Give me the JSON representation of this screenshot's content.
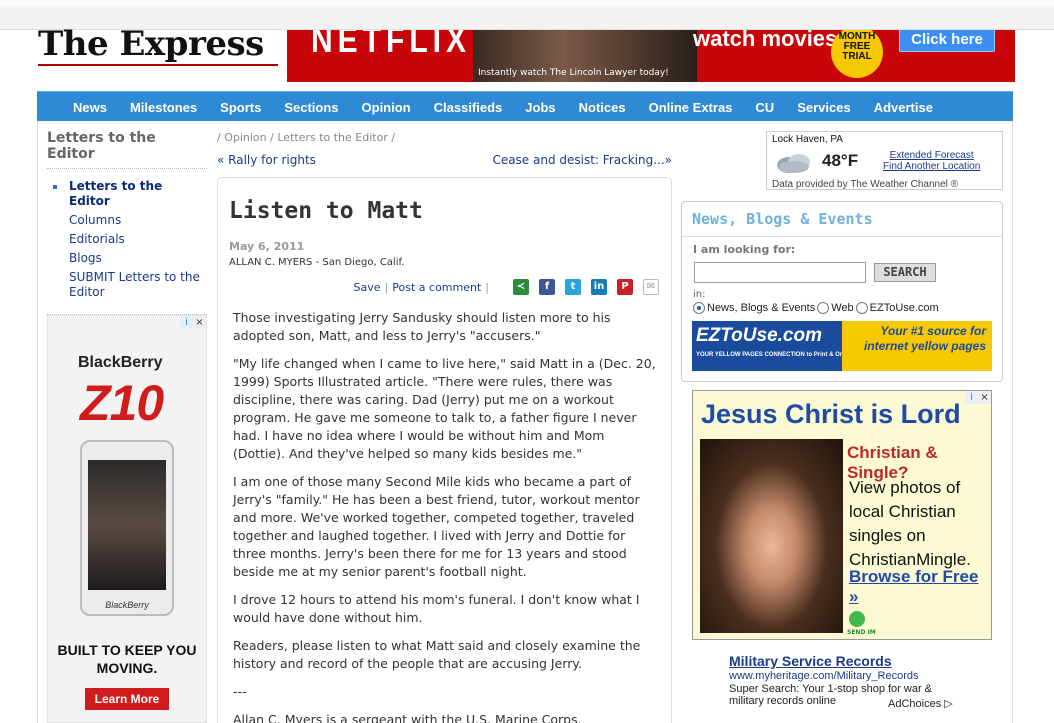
{
  "logo": {
    "title": "The Express"
  },
  "top_ad": {
    "brand": "NETFLIX",
    "caption": "Instantly watch The Lincoln Lawyer today!",
    "headline": "watch movies",
    "badge": "MONTH FREE TRIAL",
    "cta": "Click here"
  },
  "nav": {
    "items": [
      "News",
      "Milestones",
      "Sports",
      "Sections",
      "Opinion",
      "Classifieds",
      "Jobs",
      "Notices",
      "Online Extras",
      "CU",
      "Services",
      "Advertise"
    ]
  },
  "sidebar": {
    "title": "Letters to the Editor",
    "items": [
      {
        "label": "Letters to the Editor",
        "active": true
      },
      {
        "label": "Columns"
      },
      {
        "label": "Editorials"
      },
      {
        "label": "Blogs"
      },
      {
        "label": "SUBMIT Letters to the Editor"
      }
    ]
  },
  "left_ad": {
    "brand": "BlackBerry",
    "model": "Z10",
    "phone_label": "BlackBerry",
    "tagline": "BUILT TO KEEP YOU MOVING.",
    "cta": "Learn More"
  },
  "breadcrumb": "/ Opinion / Letters to the Editor /",
  "prev_link": "« Rally for rights",
  "next_link": "Cease and desist: Fracking...»",
  "article": {
    "title": "Listen to Matt",
    "date": "May 6, 2011",
    "byline": "ALLAN C. MYERS - San Diego, Calif.",
    "save": "Save",
    "separator": "|",
    "post_comment": "Post a comment",
    "share_separator": "|",
    "paragraphs": [
      "Those investigating Jerry Sandusky should listen more to his adopted son, Matt, and less to Jerry's \"accusers.\"",
      "\"My life changed when I came to live here,\" said Matt in a (Dec. 20, 1999) Sports Illustrated article. \"There were rules, there was discipline, there was caring. Dad (Jerry) put me on a workout program. He gave me someone to talk to, a father figure I never had. I have no idea where I would be without him and Mom (Dottie). And they've helped so many kids besides me.\"",
      "I am one of those many Second Mile kids who became a part of Jerry's \"family.\" He has been a best friend, tutor, workout mentor and more. We've worked together, competed together, traveled together and laughed together. I lived with Jerry and Dottie for three months. Jerry's been there for me for 13 years and stood beside me at my senior parent's football night.",
      "I drove 12 hours to attend his mom's funeral. I don't know what I would have done without him.",
      "Readers, please listen to what Matt said and closely examine the history and record of the people that are accusing Jerry.",
      "---",
      "Allan C. Myers is a sergeant with the U.S. Marine Corps."
    ]
  },
  "weather": {
    "location": "Lock Haven, PA",
    "temp": "48°F",
    "extended": "Extended Forecast",
    "another": "Find Another Location",
    "provider": "Data provided by The Weather Channel ®"
  },
  "search_box": {
    "title": "News, Blogs & Events",
    "label": "I am looking for:",
    "button": "SEARCH",
    "in_label": "in:",
    "options": [
      "News, Blogs & Events",
      "Web",
      "EZToUse.com"
    ],
    "selected": 0
  },
  "ez_ad": {
    "logo": "EZToUse.com",
    "sub": "YOUR YELLOW PAGES CONNECTION to Print & Online",
    "tag": "Your #1 source for internet yellow pages"
  },
  "right_ad": {
    "headline": "Jesus Christ is Lord",
    "sub": "Christian & Single?",
    "body": "View photos of local Christian singles on ChristianMingle.",
    "cta": "Browse for Free »",
    "send": "SEND IM"
  },
  "text_ad": {
    "title": "Military Service Records",
    "url": "www.myheritage.com/Military_Records",
    "desc": "Super Search: Your 1-stop shop for war & military records online"
  },
  "adchoices": "AdChoices ▷",
  "ad_icons": {
    "info": "i",
    "close": "×"
  },
  "share_icons": {
    "share": "≺",
    "facebook": "f",
    "twitter": "t",
    "linkedin": "in",
    "pinterest": "P",
    "email": "✉"
  },
  "colors": {
    "nav": "#2f8ad6",
    "link": "#1b3a8a",
    "ad_red": "#c8060a"
  }
}
